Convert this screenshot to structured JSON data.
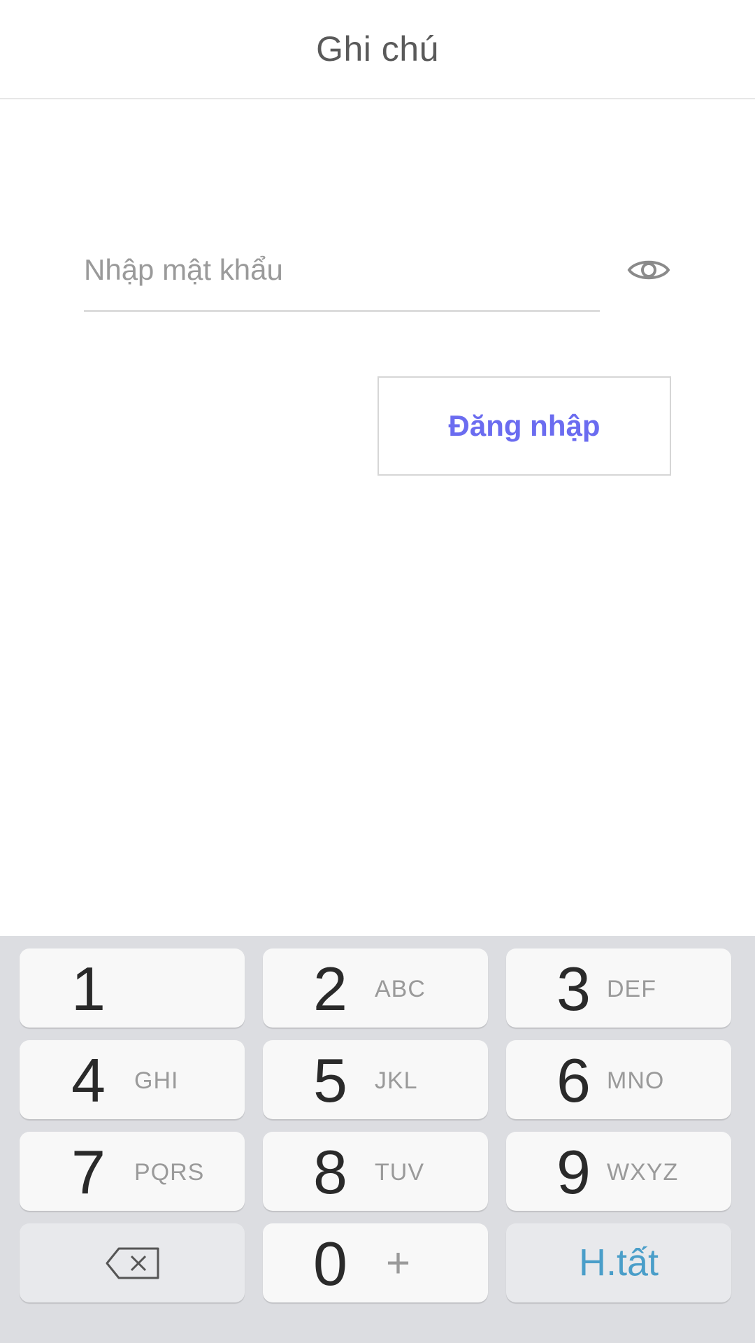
{
  "header": {
    "title": "Ghi chú"
  },
  "password": {
    "placeholder": "Nhập mật khẩu",
    "value": ""
  },
  "login": {
    "label": "Đăng nhập"
  },
  "keypad": {
    "keys": [
      {
        "digit": "1",
        "letters": ""
      },
      {
        "digit": "2",
        "letters": "ABC"
      },
      {
        "digit": "3",
        "letters": "DEF"
      },
      {
        "digit": "4",
        "letters": "GHI"
      },
      {
        "digit": "5",
        "letters": "JKL"
      },
      {
        "digit": "6",
        "letters": "MNO"
      },
      {
        "digit": "7",
        "letters": "PQRS"
      },
      {
        "digit": "8",
        "letters": "TUV"
      },
      {
        "digit": "9",
        "letters": "WXYZ"
      }
    ],
    "zero": {
      "digit": "0",
      "extra": "+"
    },
    "done_label": "H.tất"
  },
  "colors": {
    "accent": "#6b6cf0",
    "done": "#4a9ec9",
    "keypad_bg": "#dcdde1"
  }
}
